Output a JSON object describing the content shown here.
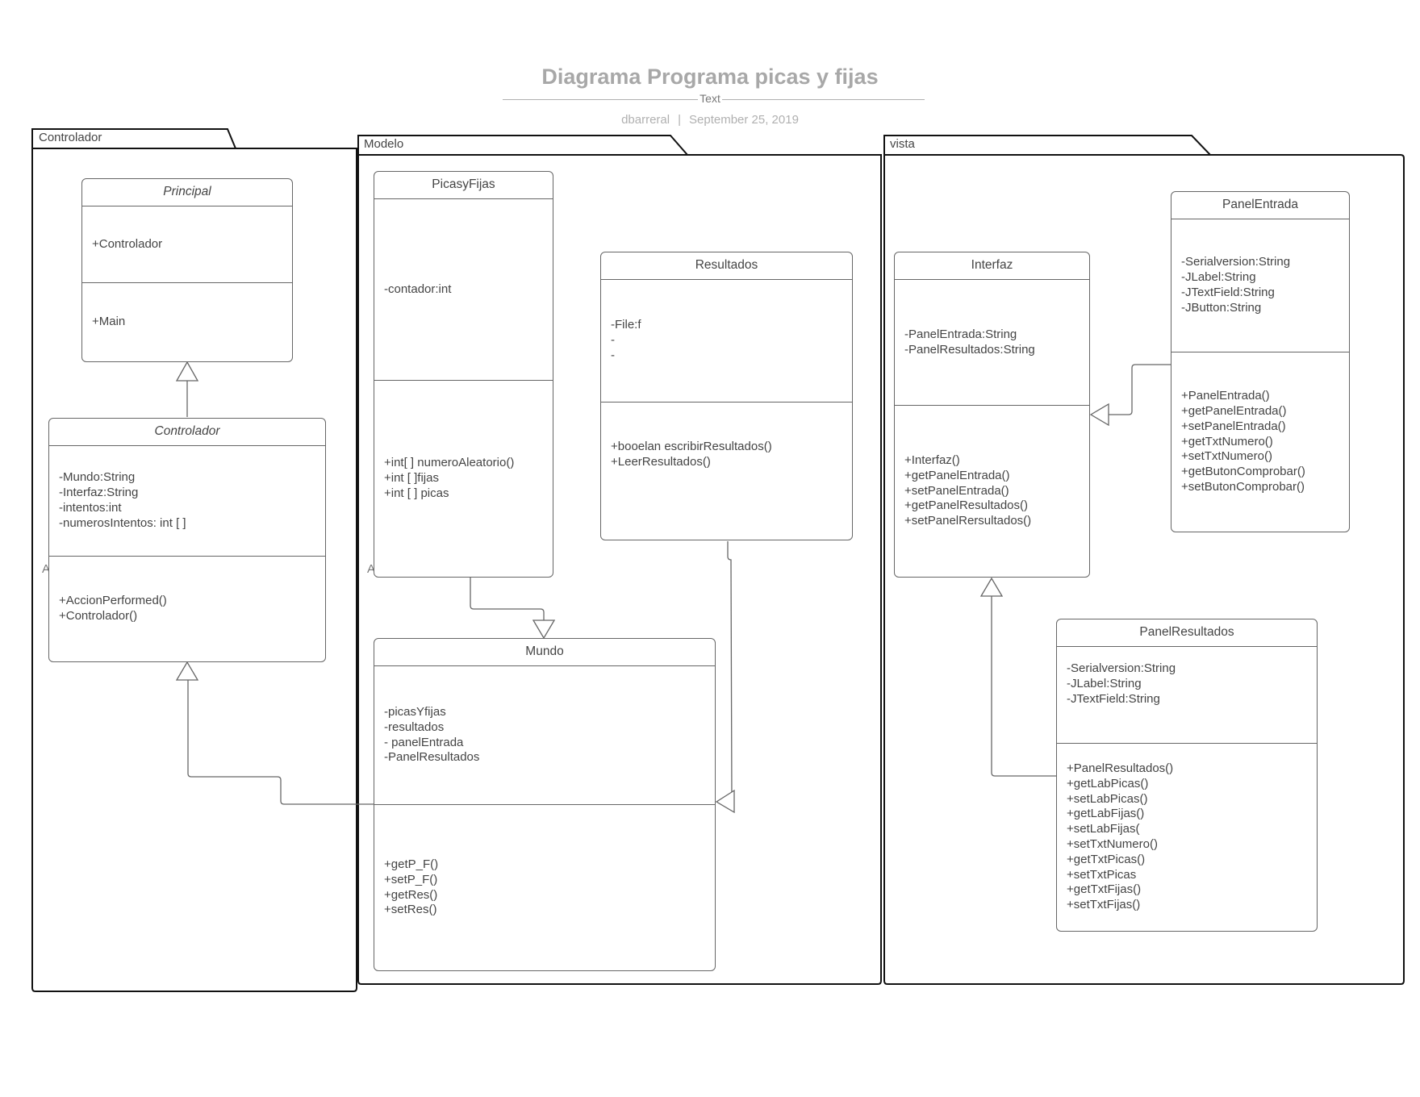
{
  "header": {
    "title": "Diagrama Programa picas y fijas",
    "subtitle": "Text",
    "author": "dbarreral",
    "separator": "|",
    "date": "September 25, 2019"
  },
  "packages": [
    {
      "id": "controlador",
      "label": "Controlador"
    },
    {
      "id": "modelo",
      "label": "Modelo"
    },
    {
      "id": "vista",
      "label": "vista"
    }
  ],
  "stray_labels": {
    "controlador_side": "A",
    "modelo_side": "A"
  },
  "classes": {
    "principal": {
      "name": "Principal",
      "attributes": [
        "+Controlador"
      ],
      "methods": [
        "+Main"
      ]
    },
    "controlador": {
      "name": "Controlador",
      "attributes": [
        "-Mundo:String",
        "-Interfaz:String",
        "-intentos:int",
        "-numerosIntentos: int [ ]"
      ],
      "methods": [
        "+AccionPerformed()",
        "+Controlador()"
      ]
    },
    "picasyfijas": {
      "name": "PicasyFijas",
      "attributes": [
        "-contador:int"
      ],
      "methods": [
        "+int[ ] numeroAleatorio()",
        "+int [ ]fijas",
        "+int [ ] picas"
      ]
    },
    "resultados": {
      "name": "Resultados",
      "attributes": [
        "-File:f",
        "-",
        "-"
      ],
      "methods": [
        "+booelan escribirResultados()",
        "+LeerResultados()"
      ]
    },
    "mundo": {
      "name": "Mundo",
      "attributes": [
        "-picasYfijas",
        "-resultados",
        "- panelEntrada",
        "-PanelResultados"
      ],
      "methods": [
        "+getP_F()",
        "+setP_F()",
        "+getRes()",
        "+setRes()"
      ]
    },
    "interfaz": {
      "name": "Interfaz",
      "attributes": [
        "-PanelEntrada:String",
        "-PanelResultados:String"
      ],
      "methods": [
        "+Interfaz()",
        "+getPanelEntrada()",
        "+setPanelEntrada()",
        "+getPanelResultados()",
        "+setPanelRersultados()"
      ]
    },
    "panelentrada": {
      "name": "PanelEntrada",
      "attributes": [
        "-Serialversion:String",
        "-JLabel:String",
        "-JTextField:String",
        "-JButton:String"
      ],
      "methods": [
        "+PanelEntrada()",
        "+getPanelEntrada()",
        "+setPanelEntrada()",
        "+getTxtNumero()",
        "+setTxtNumero()",
        "+getButonComprobar()",
        "+setButonComprobar()"
      ]
    },
    "panelresultados": {
      "name": "PanelResultados",
      "attributes": [
        "-Serialversion:String",
        "-JLabel:String",
        "-JTextField:String"
      ],
      "methods": [
        "+PanelResultados()",
        "+getLabPicas()",
        "+setLabPicas()",
        "+getLabFijas()",
        "+setLabFijas(",
        "+setTxtNumero()",
        "+getTxtPicas()",
        "+setTxtPicas",
        "+getTxtFijas()",
        "+setTxtFijas()"
      ]
    }
  }
}
